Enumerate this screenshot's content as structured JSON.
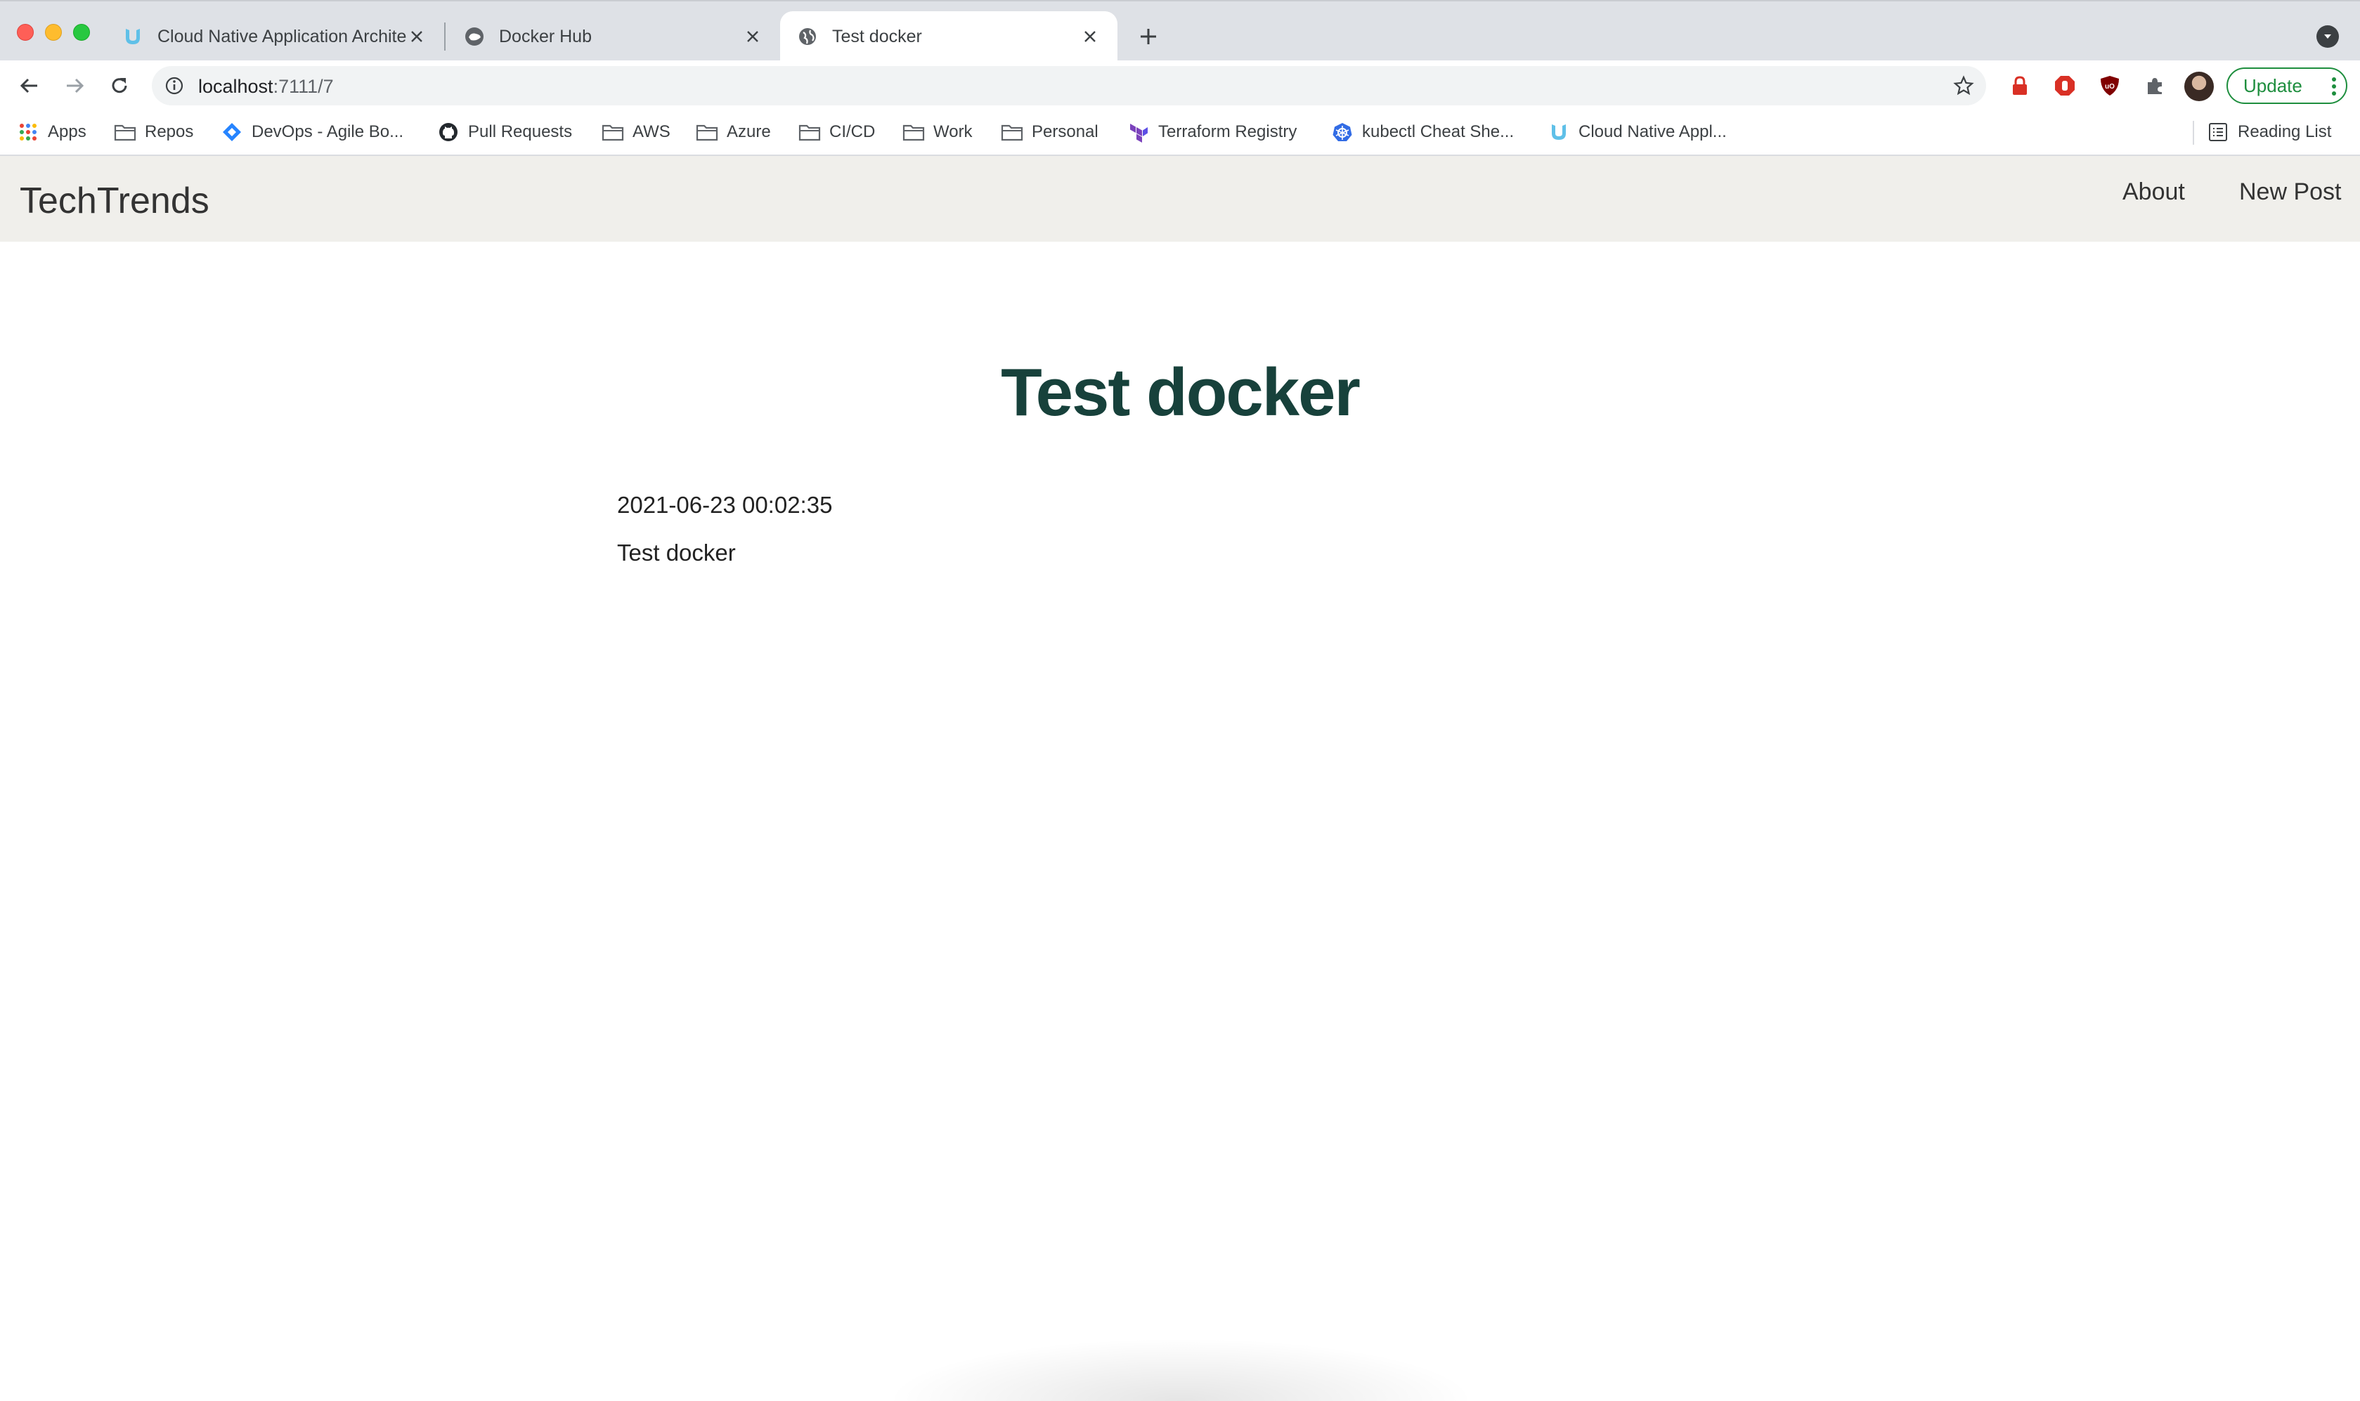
{
  "browser": {
    "tabs": [
      {
        "title": "Cloud Native Application Architecture",
        "favicon": "udacity-icon",
        "active": false
      },
      {
        "title": "Docker Hub",
        "favicon": "docker-icon",
        "active": false
      },
      {
        "title": "Test docker",
        "favicon": "globe-icon",
        "active": true
      }
    ],
    "url_host": "localhost",
    "url_path": ":7111/7",
    "update_label": "Update",
    "bookmarks": [
      {
        "label": "Apps",
        "icon": "apps-grid-icon"
      },
      {
        "label": "Repos",
        "icon": "folder-icon"
      },
      {
        "label": "DevOps - Agile Bo...",
        "icon": "jira-icon"
      },
      {
        "label": "Pull Requests",
        "icon": "github-icon"
      },
      {
        "label": "AWS",
        "icon": "folder-icon"
      },
      {
        "label": "Azure",
        "icon": "folder-icon"
      },
      {
        "label": "CI/CD",
        "icon": "folder-icon"
      },
      {
        "label": "Work",
        "icon": "folder-icon"
      },
      {
        "label": "Personal",
        "icon": "folder-icon"
      },
      {
        "label": "Terraform Registry",
        "icon": "terraform-icon"
      },
      {
        "label": "kubectl Cheat She...",
        "icon": "kubernetes-icon"
      },
      {
        "label": "Cloud Native Appl...",
        "icon": "udacity-icon"
      }
    ],
    "reading_list_label": "Reading List"
  },
  "site": {
    "brand": "TechTrends",
    "nav": [
      {
        "label": "About"
      },
      {
        "label": "New Post"
      }
    ]
  },
  "post": {
    "title": "Test docker",
    "date": "2021-06-23 00:02:35",
    "body": "Test docker"
  },
  "colors": {
    "navbar_bg": "#f0efeb",
    "title_color": "#17413b",
    "update_green": "#1e8e3e"
  }
}
